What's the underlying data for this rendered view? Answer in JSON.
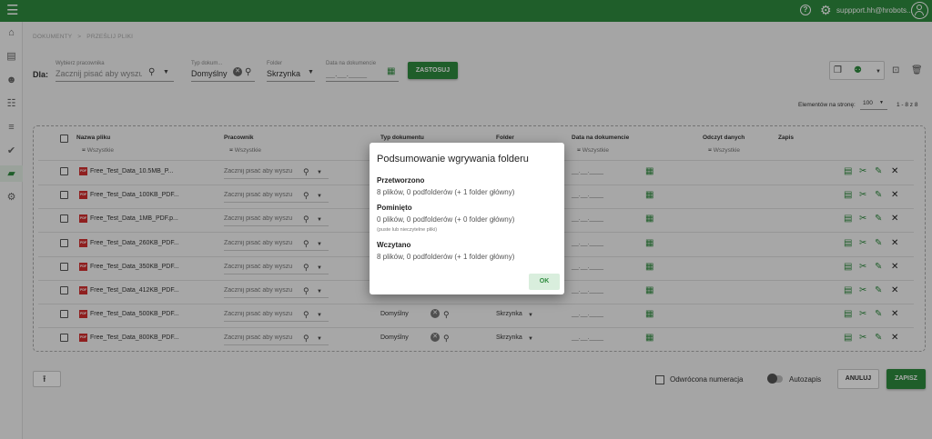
{
  "header": {
    "user": "suppport.hh@hrobots..."
  },
  "breadcrumb": {
    "item1": "DOKUMENTY",
    "sep": ">",
    "item2": "PRZEŚLIJ PLIKI"
  },
  "filters": {
    "dla_label": "Dla:",
    "employee_label": "Wybierz pracownika",
    "employee_placeholder": "Zacznij pisać aby wyszu",
    "doctype_label": "Typ dokum...",
    "doctype_value": "Domyślny",
    "folder_label": "Folder",
    "folder_value": "Skrzynka",
    "date_label": "Data na dokumencie",
    "date_value": "__.__.____",
    "apply_label": "ZASTOSUJ"
  },
  "pagination": {
    "per_page_label": "Elementów na stronę:",
    "per_page_value": "100",
    "range": "1 - 8 z 8"
  },
  "table": {
    "columns": {
      "name": "Nazwa pliku",
      "employee": "Pracownik",
      "doctype": "Typ dokumentu",
      "folder": "Folder",
      "date": "Data na dokumencie",
      "ocr": "Odczyt danych",
      "save": "Zapis"
    },
    "filter_all": "Wszystkie",
    "employee_placeholder": "Zacznij pisać aby wyszu",
    "date_placeholder": "__.__.____",
    "rows": [
      {
        "name": "Free_Test_Data_10.5MB_P...",
        "doctype": "",
        "folder": ""
      },
      {
        "name": "Free_Test_Data_100KB_PDF...",
        "doctype": "",
        "folder": ""
      },
      {
        "name": "Free_Test_Data_1MB_PDF.p...",
        "doctype": "",
        "folder": ""
      },
      {
        "name": "Free_Test_Data_260KB_PDF...",
        "doctype": "",
        "folder": ""
      },
      {
        "name": "Free_Test_Data_350KB_PDF...",
        "doctype": "",
        "folder": ""
      },
      {
        "name": "Free_Test_Data_412KB_PDF...",
        "doctype": "",
        "folder": ""
      },
      {
        "name": "Free_Test_Data_500KB_PDF...",
        "doctype": "Domyślny",
        "folder": "Skrzynka"
      },
      {
        "name": "Free_Test_Data_800KB_PDF...",
        "doctype": "Domyślny",
        "folder": "Skrzynka"
      }
    ]
  },
  "footer": {
    "reverse_label": "Odwrócona numeracja",
    "autosave_label": "Autozapis",
    "cancel_label": "ANULUJ",
    "save_label": "ZAPISZ"
  },
  "dialog": {
    "title": "Podsumowanie wgrywania folderu",
    "processed_heading": "Przetworzono",
    "processed_text": "8 plików, 0 podfolderów (+ 1 folder główny)",
    "skipped_heading": "Pominięto",
    "skipped_text": "0 plików, 0 podfolderów (+ 0 folder główny)",
    "skipped_note": "(puste lub nieczytelne pliki)",
    "loaded_heading": "Wczytano",
    "loaded_text": "8 plików, 0 podfolderów (+ 1 folder główny)",
    "ok_label": "OK"
  },
  "colors": {
    "accent": "#2e8b3e",
    "pdf": "#d32f2f"
  }
}
